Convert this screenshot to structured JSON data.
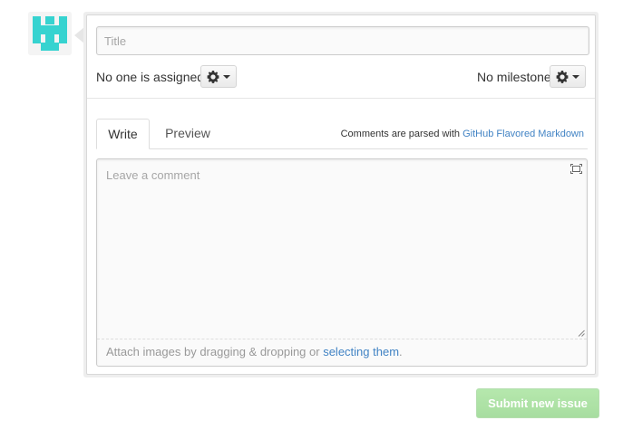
{
  "avatar": {
    "icon": "identicon",
    "color": "#36d3d0"
  },
  "title_field": {
    "placeholder": "Title",
    "value": ""
  },
  "assignee": {
    "label": "No one is assigned",
    "button_icon": "gear-icon"
  },
  "milestone": {
    "label": "No milestone",
    "button_icon": "gear-icon"
  },
  "tabs": [
    {
      "label": "Write",
      "active": true
    },
    {
      "label": "Preview",
      "active": false
    }
  ],
  "markdown_note": {
    "prefix": "Comments are parsed with ",
    "link": "GitHub Flavored Markdown"
  },
  "comment": {
    "placeholder": "Leave a comment",
    "value": ""
  },
  "attach": {
    "prefix": "Attach images by dragging & dropping or ",
    "link": "selecting them",
    "suffix": "."
  },
  "submit": {
    "label": "Submit new issue",
    "color": "#9fdd95",
    "enabled": false
  },
  "colors": {
    "link": "#4183c4",
    "border": "#cccccc"
  }
}
